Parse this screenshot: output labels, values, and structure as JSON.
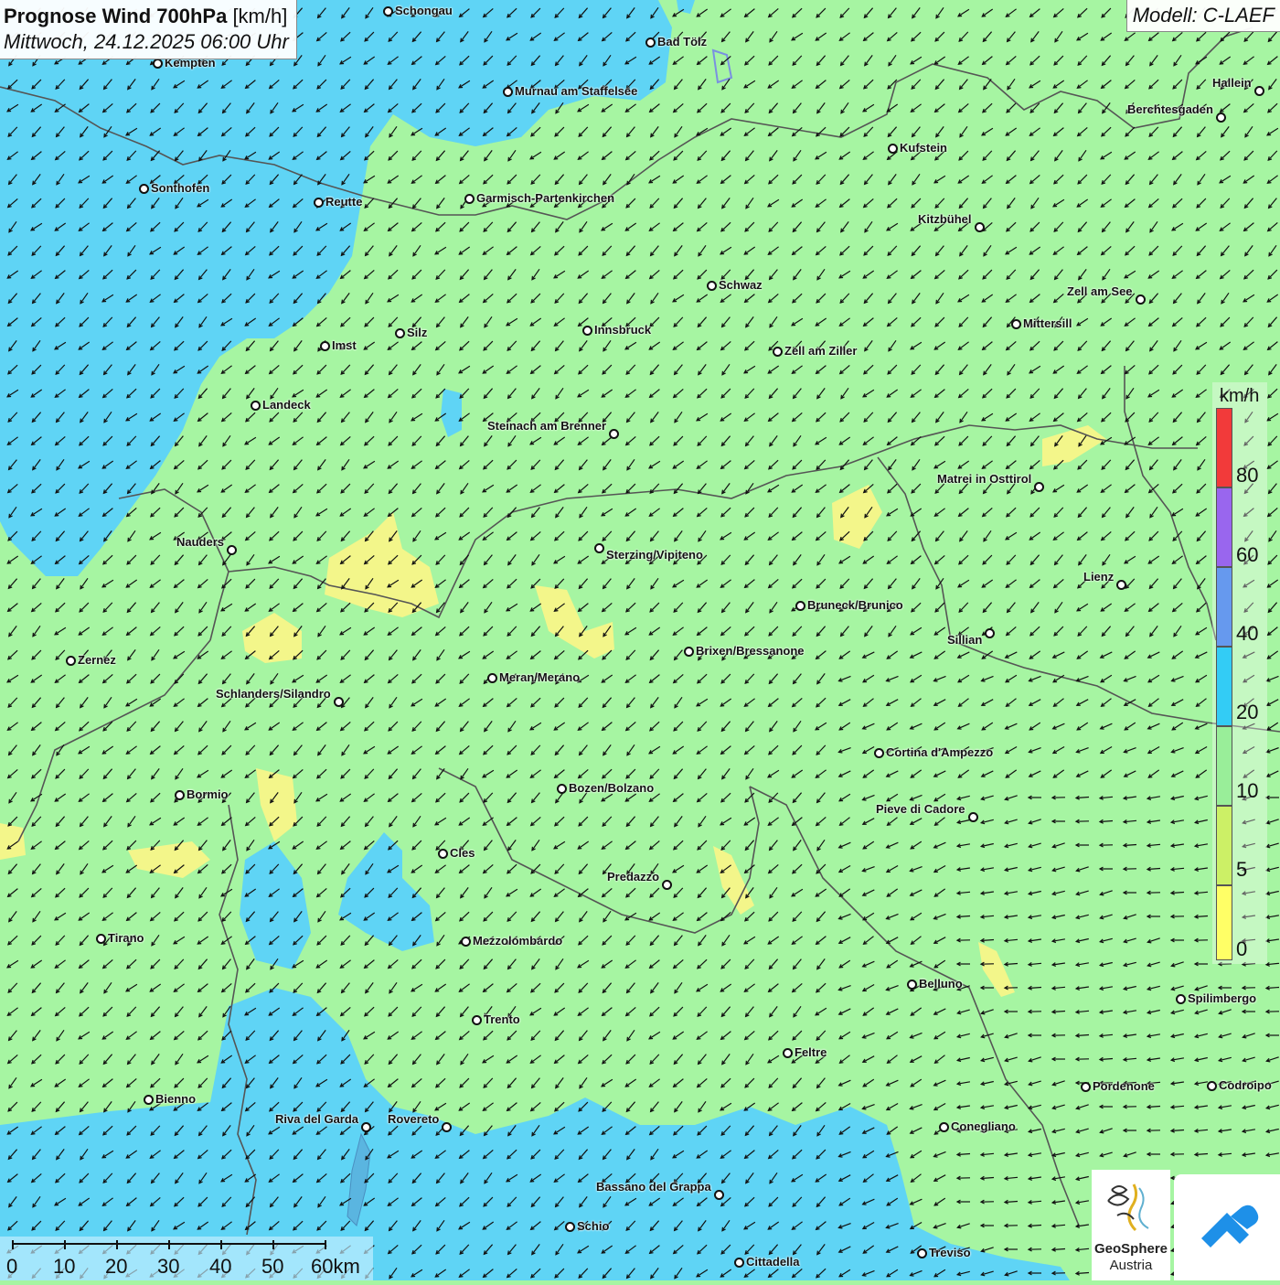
{
  "header": {
    "title": "Prognose Wind 700hPa",
    "unit": "[km/h]",
    "datetime": "Mittwoch, 24.12.2025 06:00 Uhr",
    "model": "Modell: C-LAEF"
  },
  "legend": {
    "unit": "km/h",
    "labels": [
      "80",
      "60",
      "40",
      "20",
      "10",
      "5",
      "0"
    ],
    "colors": [
      "#f23a3a",
      "#9966ee",
      "#6699ee",
      "#33ccf5",
      "#99ee99",
      "#ccf066",
      "#ffff66"
    ]
  },
  "scale": {
    "labels": [
      "0",
      "10",
      "20",
      "30",
      "40",
      "50",
      "60km"
    ]
  },
  "logos": {
    "geosphere_name": "GeoSphere",
    "geosphere_sub": "Austria"
  },
  "colors": {
    "wind_0_5": "#f3f68a",
    "wind_10_20": "#a6f5a2",
    "wind_20_40": "#5fd4f5",
    "arrow": "#111111",
    "border": "#555555"
  },
  "cities": [
    {
      "name": "Schongau"
    },
    {
      "name": "Bad Tölz"
    },
    {
      "name": "Kempten"
    },
    {
      "name": "Murnau am Staffelsee"
    },
    {
      "name": "Hallein"
    },
    {
      "name": "Berchtesgaden"
    },
    {
      "name": "Kufstein"
    },
    {
      "name": "Sonthofen"
    },
    {
      "name": "Reutte"
    },
    {
      "name": "Garmisch-Partenkirchen"
    },
    {
      "name": "Kitzbühel"
    },
    {
      "name": "Schwaz"
    },
    {
      "name": "Zell am See"
    },
    {
      "name": "Mittersill"
    },
    {
      "name": "Imst"
    },
    {
      "name": "Silz"
    },
    {
      "name": "Innsbruck"
    },
    {
      "name": "Zell am Ziller"
    },
    {
      "name": "Landeck"
    },
    {
      "name": "Steinach am Brenner"
    },
    {
      "name": "Matrei in Osttirol"
    },
    {
      "name": "Nauders"
    },
    {
      "name": "Sterzing/Vipiteno"
    },
    {
      "name": "Lienz"
    },
    {
      "name": "Bruneck/Brunico"
    },
    {
      "name": "Sillian"
    },
    {
      "name": "Zernez"
    },
    {
      "name": "Brixen/Bressanone"
    },
    {
      "name": "Meran/Merano"
    },
    {
      "name": "Schlanders/Silandro"
    },
    {
      "name": "Cortina d'Ampezzo"
    },
    {
      "name": "Bozen/Bolzano"
    },
    {
      "name": "Bormio"
    },
    {
      "name": "Pieve di Cadore"
    },
    {
      "name": "Cles"
    },
    {
      "name": "Predazzo"
    },
    {
      "name": "Tirano"
    },
    {
      "name": "Mezzolombardo"
    },
    {
      "name": "Belluno"
    },
    {
      "name": "Spilimbergo"
    },
    {
      "name": "Trento"
    },
    {
      "name": "Feltre"
    },
    {
      "name": "Bienno"
    },
    {
      "name": "Pordenone"
    },
    {
      "name": "Codroipo"
    },
    {
      "name": "Riva del Garda"
    },
    {
      "name": "Rovereto"
    },
    {
      "name": "Conegliano"
    },
    {
      "name": "Bassano del Grappa"
    },
    {
      "name": "Schio"
    },
    {
      "name": "Treviso"
    },
    {
      "name": "Cittadella"
    }
  ]
}
